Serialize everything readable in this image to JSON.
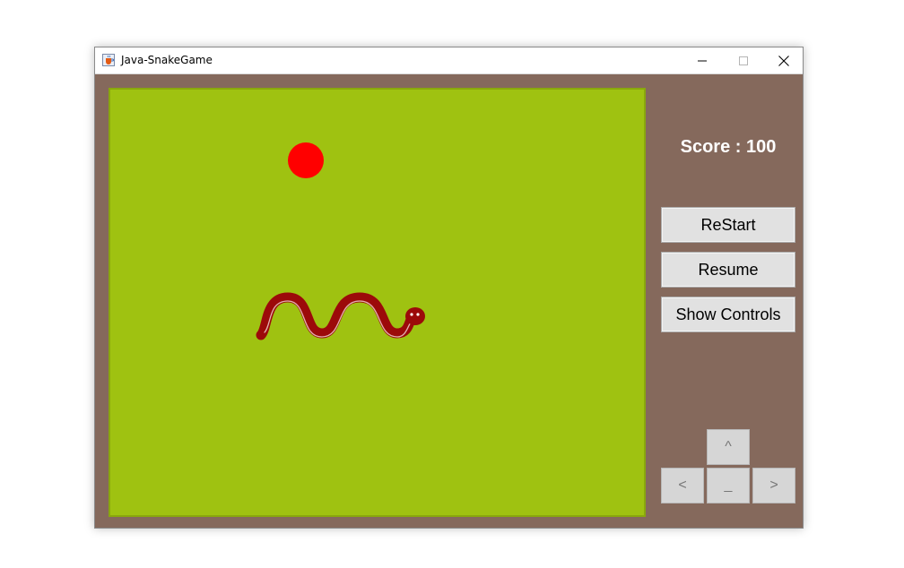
{
  "window": {
    "title": "Java-SnakeGame",
    "icon": "java-coffee-icon"
  },
  "game": {
    "board_color": "#9fc211",
    "food_color": "#ff0000",
    "snake_color": "#9c0a0a"
  },
  "sidebar": {
    "score_text": "Score : 100",
    "buttons": {
      "restart": "ReStart",
      "resume": "Resume",
      "show_controls": "Show Controls"
    },
    "arrows": {
      "up": "^",
      "left": "<",
      "down": "_",
      "right": ">"
    }
  },
  "colors": {
    "background": "#85695c",
    "button_face": "#e1e1e1",
    "arrow_face": "#d6d6d6"
  }
}
